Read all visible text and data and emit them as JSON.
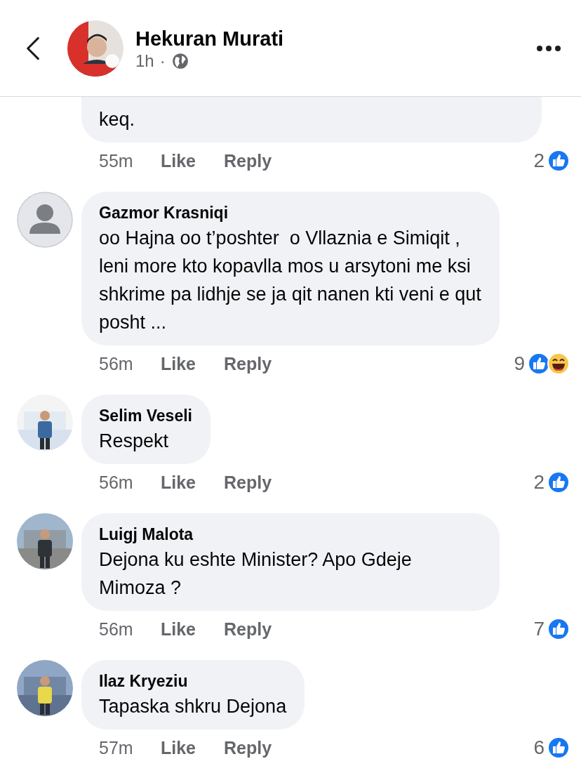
{
  "header": {
    "author": "Hekuran Murati",
    "time": "1h",
    "separator": "·",
    "avatar": {
      "kind": "picture"
    }
  },
  "top_comment": {
    "text": "keq.",
    "time": "55m",
    "like": "Like",
    "reply": "Reply",
    "reaction_count": "2",
    "reactions": [
      {
        "kind": "like"
      }
    ]
  },
  "comments": [
    {
      "name": "Gazmor Krasniqi",
      "text": "oo Hajna oo t’poshter  o Vllaznia e Simiqit , leni more kto kopavlla mos u arsytoni me ksi shkrime pa lidhje se ja qit nanen kti veni e qut posht ...",
      "avatar": {
        "kind": "default"
      },
      "time": "56m",
      "like": "Like",
      "reply": "Reply",
      "reaction_count": "9",
      "reactions": [
        {
          "kind": "like"
        },
        {
          "kind": "haha"
        }
      ]
    },
    {
      "name": "Selim Veseli",
      "text": "Respekt",
      "avatar": {
        "kind": "picture"
      },
      "time": "56m",
      "like": "Like",
      "reply": "Reply",
      "reaction_count": "2",
      "reactions": [
        {
          "kind": "like"
        }
      ]
    },
    {
      "name": "Luigj Malota",
      "text": "Dejona ku eshte Minister? Apo Gdeje Mimoza ?",
      "avatar": {
        "kind": "picture"
      },
      "time": "56m",
      "like": "Like",
      "reply": "Reply",
      "reaction_count": "7",
      "reactions": [
        {
          "kind": "like"
        }
      ]
    },
    {
      "name": "Ilaz Kryeziu",
      "text": "Tapaska shkru Dejona",
      "avatar": {
        "kind": "picture"
      },
      "time": "57m",
      "like": "Like",
      "reply": "Reply",
      "reaction_count": "6",
      "reactions": [
        {
          "kind": "like"
        }
      ]
    }
  ]
}
